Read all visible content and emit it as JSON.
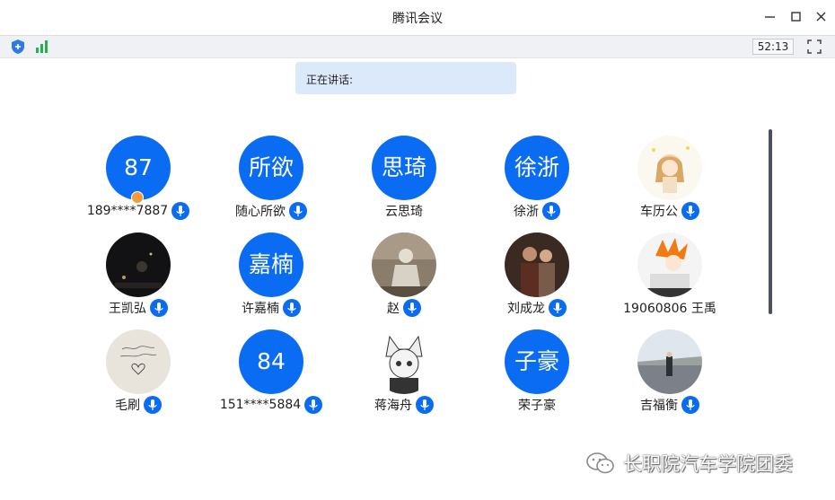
{
  "window": {
    "title": "腾讯会议"
  },
  "toolbar": {
    "timer": "52:13",
    "shield_icon": "security-shield-icon",
    "signal_icon": "network-signal-icon",
    "fullscreen_icon": "fullscreen-icon"
  },
  "speaking": {
    "label": "正在讲话:"
  },
  "colors": {
    "accent": "#0a6cf3",
    "speaking_bg": "#dbe9fb",
    "host_badge": "#f39b38"
  },
  "participants": [
    {
      "avatar_text": "87",
      "name": "189****7887",
      "mic": true,
      "host": true
    },
    {
      "avatar_text": "所欲",
      "name": "随心所欲",
      "mic": true
    },
    {
      "avatar_text": "思琦",
      "name": "云思琦",
      "mic": false
    },
    {
      "avatar_text": "徐浙",
      "name": "徐浙",
      "mic": true
    },
    {
      "avatar_image": "cartoon-girl-avatar",
      "name": "车历公",
      "mic": true
    },
    {
      "avatar_image": "night-city-avatar",
      "name": "王凯弘",
      "mic": true
    },
    {
      "avatar_text": "嘉楠",
      "name": "许嘉楠",
      "mic": true
    },
    {
      "avatar_image": "person-sitting-avatar",
      "name": "赵",
      "mic": true
    },
    {
      "avatar_image": "couple-photo-avatar",
      "name": "刘成龙",
      "mic": true
    },
    {
      "avatar_image": "anime-character-avatar",
      "name": "19060806 王禹",
      "mic": false
    },
    {
      "avatar_image": "handwritten-note-avatar",
      "name": "毛刷",
      "mic": true
    },
    {
      "avatar_text": "84",
      "name": "151****5884",
      "mic": true
    },
    {
      "avatar_image": "anime-catgirl-avatar",
      "name": "蒋海舟",
      "mic": true
    },
    {
      "avatar_text": "子豪",
      "name": "荣子豪",
      "mic": false
    },
    {
      "avatar_image": "road-person-avatar",
      "name": "吉福衡",
      "mic": true
    }
  ],
  "watermark": {
    "text": "长职院汽车学院团委",
    "icon": "wechat-icon"
  }
}
